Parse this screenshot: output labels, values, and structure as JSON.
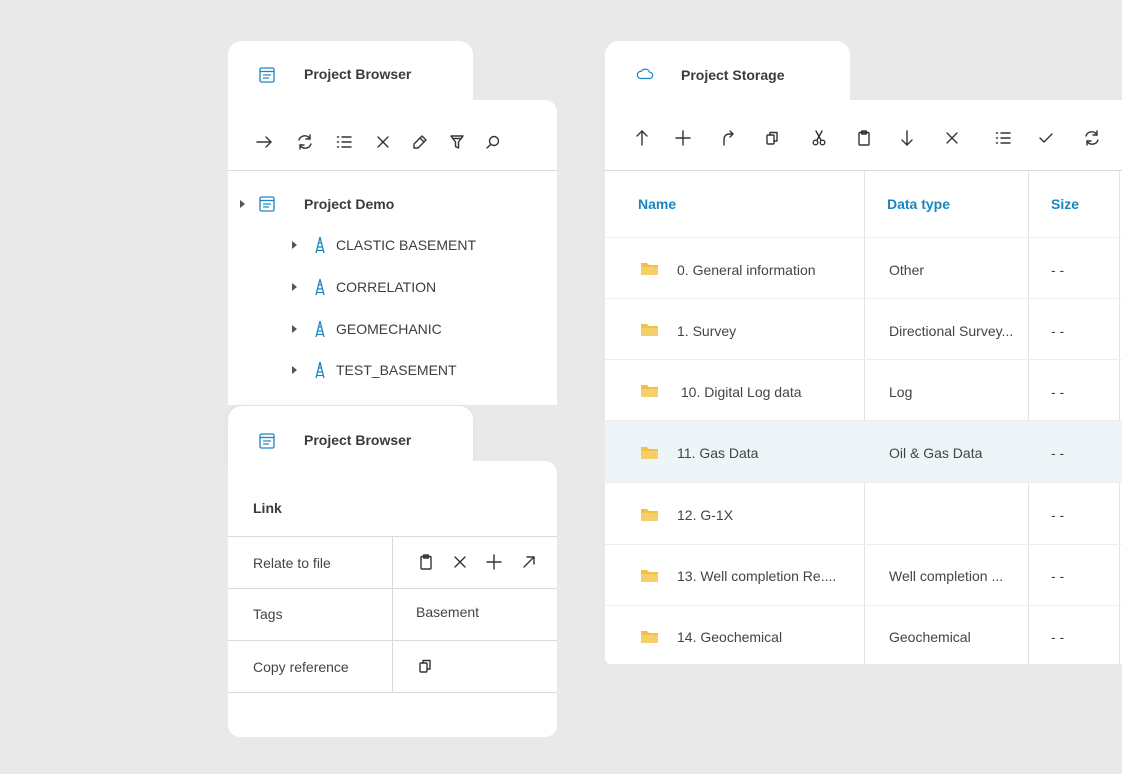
{
  "left_panel_top": {
    "title": "Project Browser",
    "tree": {
      "root": "Project Demo",
      "children": [
        {
          "label": "CLASTIC BASEMENT"
        },
        {
          "label": "CORRELATION"
        },
        {
          "label": "GEOMECHANIC"
        },
        {
          "label": "TEST_BASEMENT"
        }
      ]
    }
  },
  "left_panel_bottom": {
    "title": "Project Browser",
    "section_title": "Link",
    "properties": [
      {
        "label": "Relate to file"
      },
      {
        "label": "Tags",
        "value": "Basement"
      },
      {
        "label": "Copy reference"
      }
    ]
  },
  "right_panel": {
    "title": "Project Storage",
    "columns": [
      "Name",
      "Data type",
      "Size"
    ],
    "rows": [
      {
        "name": "0. General information",
        "type": "Other",
        "size": "- -"
      },
      {
        "name": "1. Survey",
        "type": "Directional Survey...",
        "size": "- -"
      },
      {
        "name": " 10. Digital Log data",
        "type": "Log",
        "size": "- -"
      },
      {
        "name": "11. Gas Data",
        "type": "Oil & Gas Data",
        "size": "- -"
      },
      {
        "name": "12. G-1X",
        "type": "",
        "size": "- -"
      },
      {
        "name": "13. Well completion Re....",
        "type": "Well completion ...",
        "size": "- -"
      },
      {
        "name": "14. Geochemical",
        "type": "Geochemical",
        "size": "- -"
      }
    ]
  },
  "colors": {
    "accent": "#1a86c0",
    "selected_row": "#eef5f9",
    "folder": "#f0c244",
    "background": "#e9e9e9"
  }
}
